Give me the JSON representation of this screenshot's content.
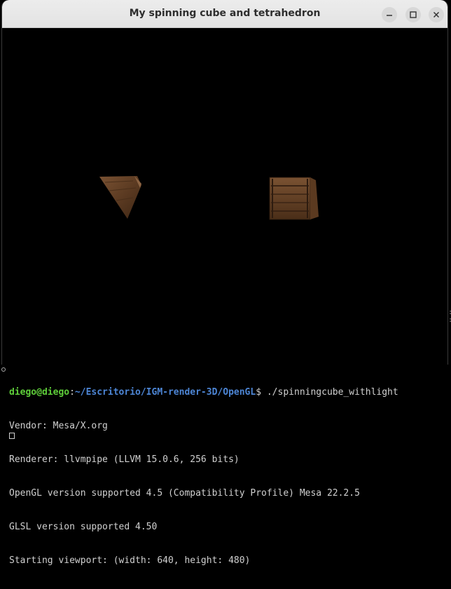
{
  "window": {
    "title": "My spinning cube and tetrahedron",
    "controls": {
      "minimize_icon": "minimize-icon",
      "maximize_icon": "maximize-icon",
      "close_icon": "close-icon"
    }
  },
  "scene": {
    "background": "#000000",
    "objects": [
      "tetrahedron",
      "cube"
    ],
    "texture_color": "#6b4526"
  },
  "terminal": {
    "prompt_user": "diego@diego",
    "prompt_sep": ":",
    "prompt_path": "~/Escritorio/IGM-render-3D/OpenGL",
    "prompt_symbol": "$ ",
    "command": "./spinningcube_withlight",
    "output": [
      "Vendor: Mesa/X.org",
      "Renderer: llvmpipe (LLVM 15.0.6, 256 bits)",
      "OpenGL version supported 4.5 (Compatibility Profile) Mesa 22.2.5",
      "GLSL version supported 4.50",
      "Starting viewport: (width: 640, height: 480)"
    ]
  },
  "colors": {
    "prompt_user": "#5fcf3a",
    "prompt_path": "#4d86d6",
    "terminal_text": "#d0d0d0",
    "titlebar": "#e8e8e8"
  }
}
